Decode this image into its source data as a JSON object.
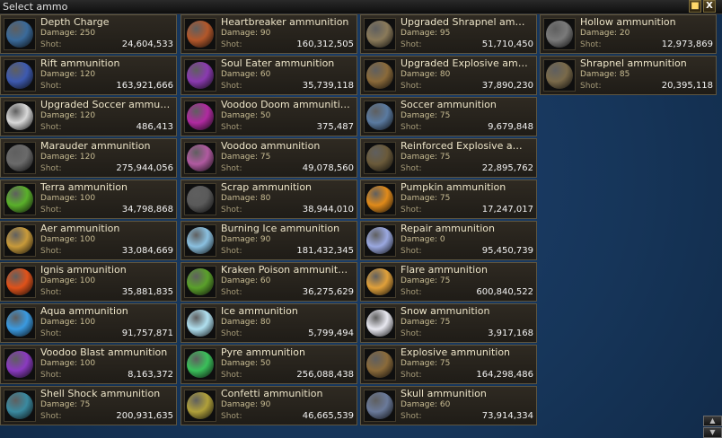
{
  "window": {
    "title": "Select ammo",
    "lock_icon": "lock-icon",
    "close_label": "X"
  },
  "labels": {
    "damage_prefix": "Damage: ",
    "shot": "Shot:"
  },
  "ammo": [
    {
      "name": "Depth Charge",
      "damage": "250",
      "shot": "24,604,533",
      "icon": "depth-charge-icon",
      "color": "#3a6a9a"
    },
    {
      "name": "Heartbreaker ammunition",
      "damage": "90",
      "shot": "160,312,505",
      "icon": "heartbreaker-icon",
      "color": "#b3572a"
    },
    {
      "name": "Upgraded Shrapnel am…",
      "damage": "95",
      "shot": "51,710,450",
      "icon": "upgraded-shrapnel-icon",
      "color": "#8a7a5a"
    },
    {
      "name": "Hollow ammunition",
      "damage": "20",
      "shot": "12,973,869",
      "icon": "hollow-icon",
      "color": "#7a7a7a"
    },
    {
      "name": "Rift ammunition",
      "damage": "120",
      "shot": "163,921,666",
      "icon": "rift-icon",
      "color": "#3d5ab0"
    },
    {
      "name": "Soul Eater ammunition",
      "damage": "60",
      "shot": "35,739,118",
      "icon": "soul-eater-icon",
      "color": "#8a3ab0"
    },
    {
      "name": "Upgraded Explosive am…",
      "damage": "80",
      "shot": "37,890,230",
      "icon": "upgraded-explosive-icon",
      "color": "#8a6a3a"
    },
    {
      "name": "Shrapnel ammunition",
      "damage": "85",
      "shot": "20,395,118",
      "icon": "shrapnel-icon",
      "color": "#7a6a4a"
    },
    {
      "name": "Upgraded Soccer ammu…",
      "damage": "120",
      "shot": "486,413",
      "icon": "upgraded-soccer-icon",
      "color": "#d8d8d8"
    },
    {
      "name": "Voodoo Doom ammuniti…",
      "damage": "50",
      "shot": "375,487",
      "icon": "voodoo-doom-icon",
      "color": "#b02aa0"
    },
    {
      "name": "Soccer ammunition",
      "damage": "75",
      "shot": "9,679,848",
      "icon": "soccer-icon",
      "color": "#5a7aa0"
    },
    {
      "name": "Marauder ammunition",
      "damage": "120",
      "shot": "275,944,056",
      "icon": "marauder-icon",
      "color": "#6a6a6a"
    },
    {
      "name": "Voodoo ammunition",
      "damage": "75",
      "shot": "49,078,560",
      "icon": "voodoo-icon",
      "color": "#b05aa0"
    },
    {
      "name": "Reinforced Explosive a…",
      "damage": "75",
      "shot": "22,895,762",
      "icon": "reinforced-explosive-icon",
      "color": "#6a5a3a"
    },
    {
      "name": "Terra ammunition",
      "damage": "100",
      "shot": "34,798,868",
      "icon": "terra-icon",
      "color": "#5ab02a"
    },
    {
      "name": "Scrap ammunition",
      "damage": "80",
      "shot": "38,944,010",
      "icon": "scrap-icon",
      "color": "#5a5a5a"
    },
    {
      "name": "Pumpkin ammunition",
      "damage": "75",
      "shot": "17,247,017",
      "icon": "pumpkin-icon",
      "color": "#e08a1a"
    },
    {
      "name": "Aer ammunition",
      "damage": "100",
      "shot": "33,084,669",
      "icon": "aer-icon",
      "color": "#c89a3a"
    },
    {
      "name": "Burning Ice ammunition",
      "damage": "90",
      "shot": "181,432,345",
      "icon": "burning-ice-icon",
      "color": "#8ac0e0"
    },
    {
      "name": "Repair ammunition",
      "damage": "0",
      "shot": "95,450,739",
      "icon": "repair-icon",
      "color": "#9aa8e0"
    },
    {
      "name": "Ignis ammunition",
      "damage": "100",
      "shot": "35,881,835",
      "icon": "ignis-icon",
      "color": "#e0521a"
    },
    {
      "name": "Kraken Poison ammunit…",
      "damage": "60",
      "shot": "36,275,629",
      "icon": "kraken-poison-icon",
      "color": "#5aa02a"
    },
    {
      "name": "Flare ammunition",
      "damage": "75",
      "shot": "600,840,522",
      "icon": "flare-icon",
      "color": "#e0a03a"
    },
    {
      "name": "Aqua ammunition",
      "damage": "100",
      "shot": "91,757,871",
      "icon": "aqua-icon",
      "color": "#3a9ae0"
    },
    {
      "name": "Ice ammunition",
      "damage": "80",
      "shot": "5,799,494",
      "icon": "ice-icon",
      "color": "#b0e0f0"
    },
    {
      "name": "Snow ammunition",
      "damage": "75",
      "shot": "3,917,168",
      "icon": "snow-icon",
      "color": "#e8e8f0"
    },
    {
      "name": "Voodoo Blast ammunition",
      "damage": "100",
      "shot": "8,163,372",
      "icon": "voodoo-blast-icon",
      "color": "#8a3ac0"
    },
    {
      "name": "Pyre ammunition",
      "damage": "50",
      "shot": "256,088,438",
      "icon": "pyre-icon",
      "color": "#3ac05a"
    },
    {
      "name": "Explosive ammunition",
      "damage": "75",
      "shot": "164,298,486",
      "icon": "explosive-icon",
      "color": "#8a6a3a"
    },
    {
      "name": "Shell Shock ammunition",
      "damage": "75",
      "shot": "200,931,635",
      "icon": "shell-shock-icon",
      "color": "#3a8aa0"
    },
    {
      "name": "Confetti ammunition",
      "damage": "90",
      "shot": "46,665,539",
      "icon": "confetti-icon",
      "color": "#b0a03a"
    },
    {
      "name": "Skull ammunition",
      "damage": "60",
      "shot": "73,914,334",
      "icon": "skull-icon",
      "color": "#6a7a9a"
    }
  ]
}
